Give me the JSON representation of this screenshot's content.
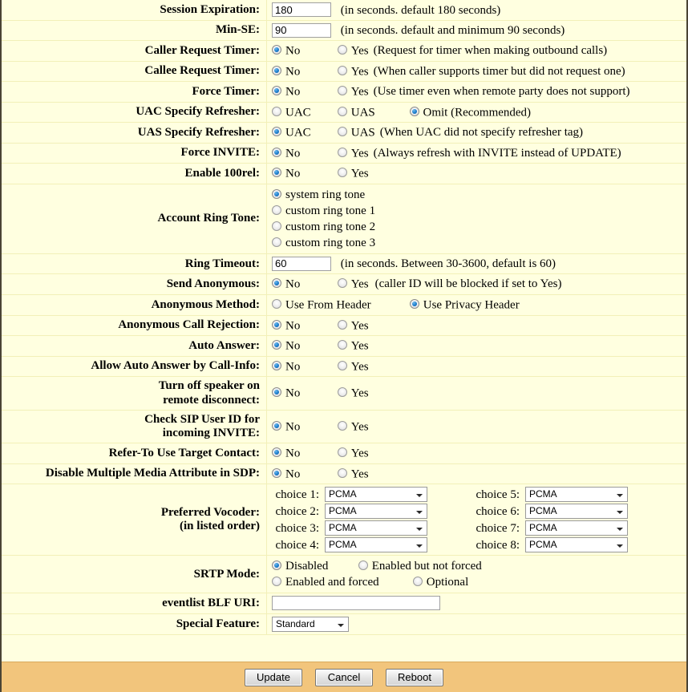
{
  "colors": {
    "page_bg": "#ffffe0",
    "footer_bg": "#f2c57c",
    "rule": "#f2f0b8",
    "border": "#4a4435",
    "radio_selected": "#1878c8"
  },
  "labels": {
    "session_expiration": "Session Expiration:",
    "min_se": "Min-SE:",
    "caller_request_timer": "Caller Request Timer:",
    "callee_request_timer": "Callee Request Timer:",
    "force_timer": "Force Timer:",
    "uac_specify_refresher": "UAC Specify Refresher:",
    "uas_specify_refresher": "UAS Specify Refresher:",
    "force_invite": "Force INVITE:",
    "enable_100rel": "Enable 100rel:",
    "account_ring_tone": "Account Ring Tone:",
    "ring_timeout": "Ring Timeout:",
    "send_anonymous": "Send Anonymous:",
    "anonymous_method": "Anonymous Method:",
    "anonymous_call_rejection": "Anonymous Call Rejection:",
    "auto_answer": "Auto Answer:",
    "allow_auto_answer_call_info": "Allow Auto Answer by Call-Info:",
    "turn_off_speaker_line1": "Turn off speaker on",
    "turn_off_speaker_line2": "remote disconnect:",
    "check_sip_user_id_line1": "Check SIP User ID for",
    "check_sip_user_id_line2": "incoming INVITE:",
    "refer_to_use_target_contact": "Refer-To Use Target Contact:",
    "disable_multiple_media": "Disable Multiple Media Attribute in SDP:",
    "preferred_vocoder_line1": "Preferred Vocoder:",
    "preferred_vocoder_line2": "(in listed order)",
    "srtp_mode": "SRTP Mode:",
    "eventlist_blf_uri": "eventlist BLF URI:",
    "special_feature": "Special Feature:"
  },
  "values": {
    "session_expiration": "180",
    "min_se": "90",
    "ring_timeout": "60",
    "eventlist_blf_uri": "",
    "special_feature": "Standard"
  },
  "hints": {
    "session_expiration": "(in seconds. default 180 seconds)",
    "min_se": "(in seconds. default and minimum 90 seconds)",
    "caller_request_timer": "(Request for timer when making outbound calls)",
    "callee_request_timer": "(When caller supports timer but did not request one)",
    "force_timer": "(Use timer even when remote party does not support)",
    "uas_specify_refresher": "(When UAC did not specify refresher tag)",
    "force_invite": "(Always refresh with INVITE instead of UPDATE)",
    "ring_timeout": "(in seconds. Between 30-3600, default is 60)",
    "send_anonymous": "(caller ID will be blocked if set to Yes)"
  },
  "options": {
    "no": "No",
    "yes": "Yes",
    "uac": "UAC",
    "uas": "UAS",
    "omit": "Omit (Recommended)",
    "use_from_header": "Use From Header",
    "use_privacy_header": "Use Privacy Header",
    "ring_tones": [
      "system ring tone",
      "custom ring tone 1",
      "custom ring tone 2",
      "custom ring tone 3"
    ],
    "srtp": [
      "Disabled",
      "Enabled but not forced",
      "Enabled and forced",
      "Optional"
    ]
  },
  "selected": {
    "caller_request_timer": "No",
    "callee_request_timer": "No",
    "force_timer": "No",
    "uac_specify_refresher": "Omit (Recommended)",
    "uas_specify_refresher": "UAC",
    "force_invite": "No",
    "enable_100rel": "No",
    "account_ring_tone": "system ring tone",
    "send_anonymous": "No",
    "anonymous_method": "Use Privacy Header",
    "anonymous_call_rejection": "No",
    "auto_answer": "No",
    "allow_auto_answer_call_info": "No",
    "turn_off_speaker": "No",
    "check_sip_user_id": "No",
    "refer_to_use_target_contact": "No",
    "disable_multiple_media": "No",
    "srtp_mode": "Disabled"
  },
  "vocoder": {
    "choice_labels": [
      "choice 1:",
      "choice 2:",
      "choice 3:",
      "choice 4:",
      "choice 5:",
      "choice 6:",
      "choice 7:",
      "choice 8:"
    ],
    "values": [
      "PCMA",
      "PCMA",
      "PCMA",
      "PCMA",
      "PCMA",
      "PCMA",
      "PCMA",
      "PCMA"
    ]
  },
  "footer": {
    "update": "Update",
    "cancel": "Cancel",
    "reboot": "Reboot"
  }
}
